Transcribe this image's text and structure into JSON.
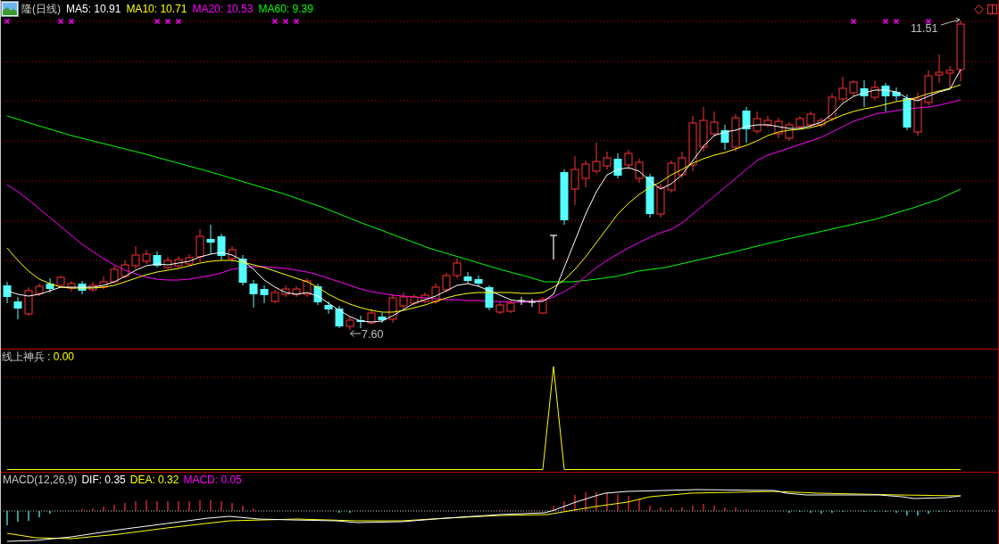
{
  "header": {
    "title": "隆(日线)",
    "moving_averages": [
      {
        "label": "MA5: 10.91",
        "color": "#ffffff"
      },
      {
        "label": "MA10: 10.71",
        "color": "#ffff00"
      },
      {
        "label": "MA20: 10.53",
        "color": "#ff00ff"
      },
      {
        "label": "MA60: 9.39",
        "color": "#00ff00"
      }
    ]
  },
  "price_chart": {
    "high_label": "11.51",
    "low_label": "7.60"
  },
  "indicator_panel": {
    "name": "线上神兵",
    "reading": ": 0.00"
  },
  "macd_panel": {
    "title": "MACD(12,26,9)",
    "readings": [
      {
        "label": "DIF: 0.35",
        "color": "#ffffff"
      },
      {
        "label": "DEA: 0.32",
        "color": "#ffff00"
      },
      {
        "label": "MACD: 0.05",
        "color": "#ff00ff"
      }
    ]
  }
}
